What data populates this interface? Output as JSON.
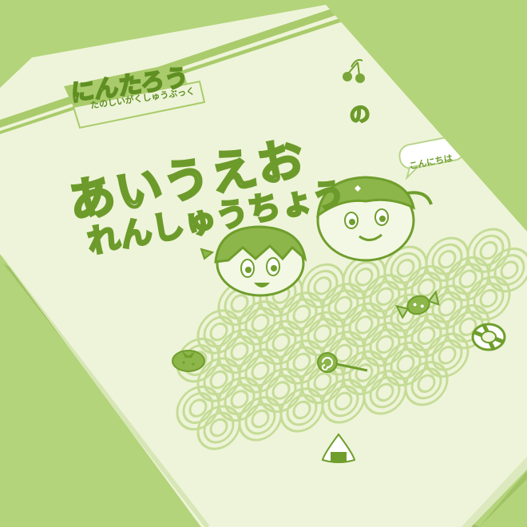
{
  "book": {
    "brand_title": "にんたろう",
    "brand_subtitle_1": "たのしいがくしゅうぶっく",
    "brand_subtitle_2": "",
    "title_line1": "あいうえお",
    "title_particle": "の",
    "title_line2": "れんしゅうちょう",
    "speech_bubble": "こんにちは"
  },
  "colors": {
    "background": "#b3d47a",
    "cover": "#eef4d9",
    "accent": "#7aa63a",
    "wave": "#d6e6b0"
  },
  "icons": [
    "cherry-icon",
    "tomato-icon",
    "candy-icon",
    "lollipop-icon",
    "swim-ring-icon",
    "rice-ball-icon"
  ]
}
